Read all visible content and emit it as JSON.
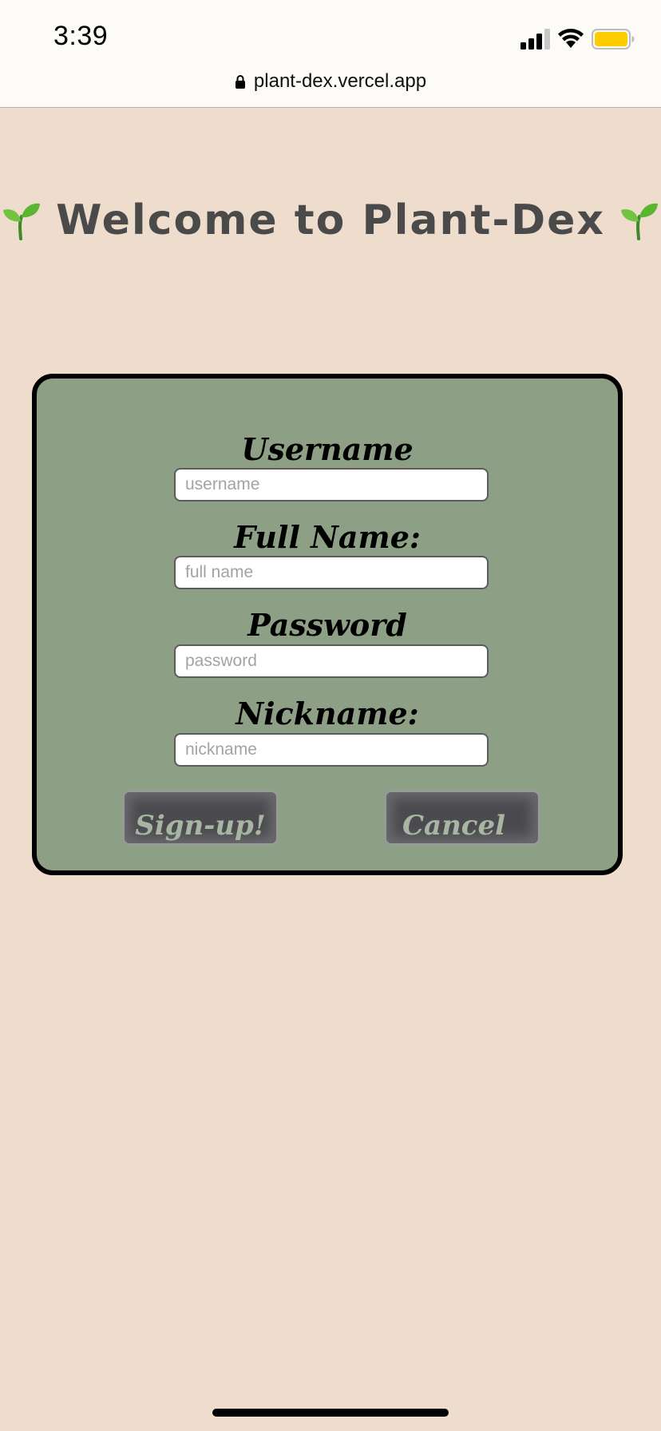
{
  "status_bar": {
    "time": "3:39",
    "icons": [
      "cellular-signal-icon",
      "wifi-icon",
      "battery-icon"
    ],
    "battery_color": "#ffcc00"
  },
  "browser": {
    "url": "plant-dex.vercel.app",
    "lock_icon": "lock-icon"
  },
  "page": {
    "title": "Welcome to Plant-Dex",
    "title_emoji_icon": "seedling-icon",
    "background_color": "#eedccd",
    "card_color": "#8da086"
  },
  "form": {
    "fields": [
      {
        "label": "Username",
        "placeholder": "username",
        "value": ""
      },
      {
        "label": "Full Name:",
        "placeholder": "full name",
        "value": ""
      },
      {
        "label": "Password",
        "placeholder": "password",
        "value": ""
      },
      {
        "label": "Nickname:",
        "placeholder": "nickname",
        "value": ""
      }
    ],
    "buttons": {
      "signup": "Sign-up!",
      "cancel": "Cancel"
    }
  }
}
